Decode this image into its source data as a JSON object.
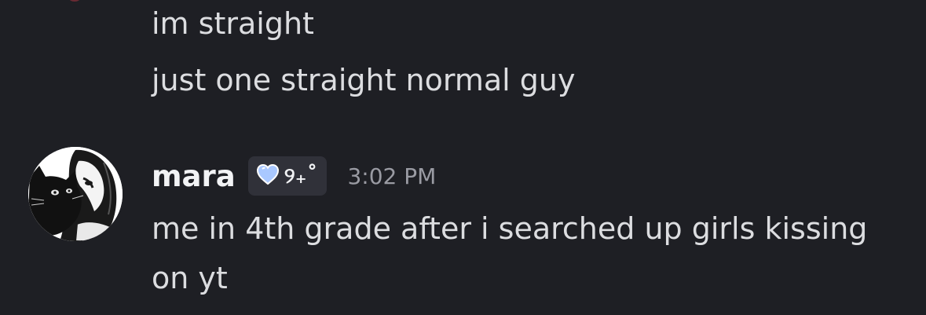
{
  "messages_above": [
    {
      "text": "im straight"
    },
    {
      "text": "just one straight normal guy"
    }
  ],
  "message": {
    "username": "mara",
    "tag_icon": "heart-icon",
    "tag_text": "୨₊˚",
    "timestamp": "3:02 PM",
    "content": "me in 4th grade after i searched up girls kissing on yt"
  },
  "colors": {
    "background": "#1e1f24",
    "text": "#dcdde0",
    "username": "#f2f3f5",
    "timestamp": "#9a9ba3",
    "badge_bg": "#303139",
    "heart": "#a9c8ff"
  }
}
